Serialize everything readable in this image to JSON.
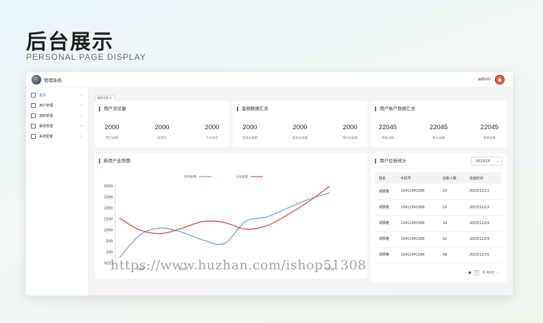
{
  "hero": {
    "title": "后台展示",
    "subtitle": "PERSONAL PAGE DISPLAY"
  },
  "app": {
    "title": "管理系统",
    "user": "admin"
  },
  "sidebar": {
    "items": [
      {
        "label": "首页",
        "icon": "dashboard-icon",
        "active": true
      },
      {
        "label": "用户管理",
        "icon": "user-icon"
      },
      {
        "label": "通知管理",
        "icon": "bell-icon"
      },
      {
        "label": "渠道管理",
        "icon": "channel-icon"
      },
      {
        "label": "系统配置",
        "icon": "settings-icon"
      }
    ]
  },
  "tabs": [
    {
      "label": "首页主页 ×"
    }
  ],
  "browse": {
    "title": "用户浏览量",
    "stats": [
      {
        "value": "2000",
        "label": "用户总数"
      },
      {
        "value": "2000",
        "label": "总浏览"
      },
      {
        "value": "2000",
        "label": "今日浏览"
      }
    ]
  },
  "amount": {
    "title": "金额数据汇总",
    "stats": [
      {
        "value": "2000",
        "label": "充值总金额"
      },
      {
        "value": "2000",
        "label": "提现总金额"
      },
      {
        "value": "2000",
        "label": "预约总金额"
      }
    ]
  },
  "account": {
    "title": "用户账户数据汇总",
    "stats": [
      {
        "value": "22045",
        "label": "佣金总数"
      },
      {
        "value": "22045",
        "label": "积分总数"
      },
      {
        "value": "22045",
        "label": "余额总数"
      }
    ]
  },
  "trend": {
    "title": "新用户走势图"
  },
  "ranking": {
    "title": "用户拉新统计",
    "month": "2023/10",
    "columns": [
      "姓名",
      "手机号",
      "拉新人数",
      "充值时间"
    ],
    "rows": [
      [
        "郑狮着",
        "13412341569",
        "10",
        "2023/12/22"
      ],
      [
        "郑狮着",
        "13412341569",
        "22",
        "2023/12/23"
      ],
      [
        "郑狮着",
        "13412341569",
        "34",
        "2023/12/24"
      ],
      [
        "郑狮着",
        "13412341569",
        "02",
        "2023/12/24"
      ],
      [
        "郑狮着",
        "13412341569",
        "56",
        "2023/12/25"
      ]
    ],
    "pager": {
      "page": "2",
      "suffix": "页 共2页"
    }
  },
  "watermark": "https://www.huzhan.com/ishop51308",
  "chart_data": {
    "type": "line",
    "title": "新用户走势图",
    "x": [
      0,
      1,
      2,
      3,
      4,
      5,
      6,
      7,
      8,
      9,
      10
    ],
    "x_tick_labels": [
      "",
      "12/3",
      "",
      "12/4",
      "",
      "",
      "",
      "",
      "",
      "",
      "12/11"
    ],
    "yticks": [
      0,
      100,
      500,
      1000,
      1500,
      2000,
      2500,
      3000
    ],
    "ytick_labels": [
      "0(万)",
      "100",
      "500",
      "1000",
      "1500",
      "2000",
      "2500",
      "3000"
    ],
    "series": [
      {
        "name": "本月新增",
        "color": "#6fa8dc",
        "values": [
          50,
          800,
          1100,
          900,
          550,
          420,
          1400,
          1600,
          2000,
          2400,
          2700
        ]
      },
      {
        "name": "上月新增",
        "color": "#d9534f",
        "values": [
          1550,
          1000,
          850,
          1100,
          1400,
          1350,
          1050,
          1200,
          1700,
          2300,
          3000
        ]
      }
    ],
    "ylim": [
      0,
      3000
    ],
    "grid": false,
    "legend": "top-center"
  }
}
